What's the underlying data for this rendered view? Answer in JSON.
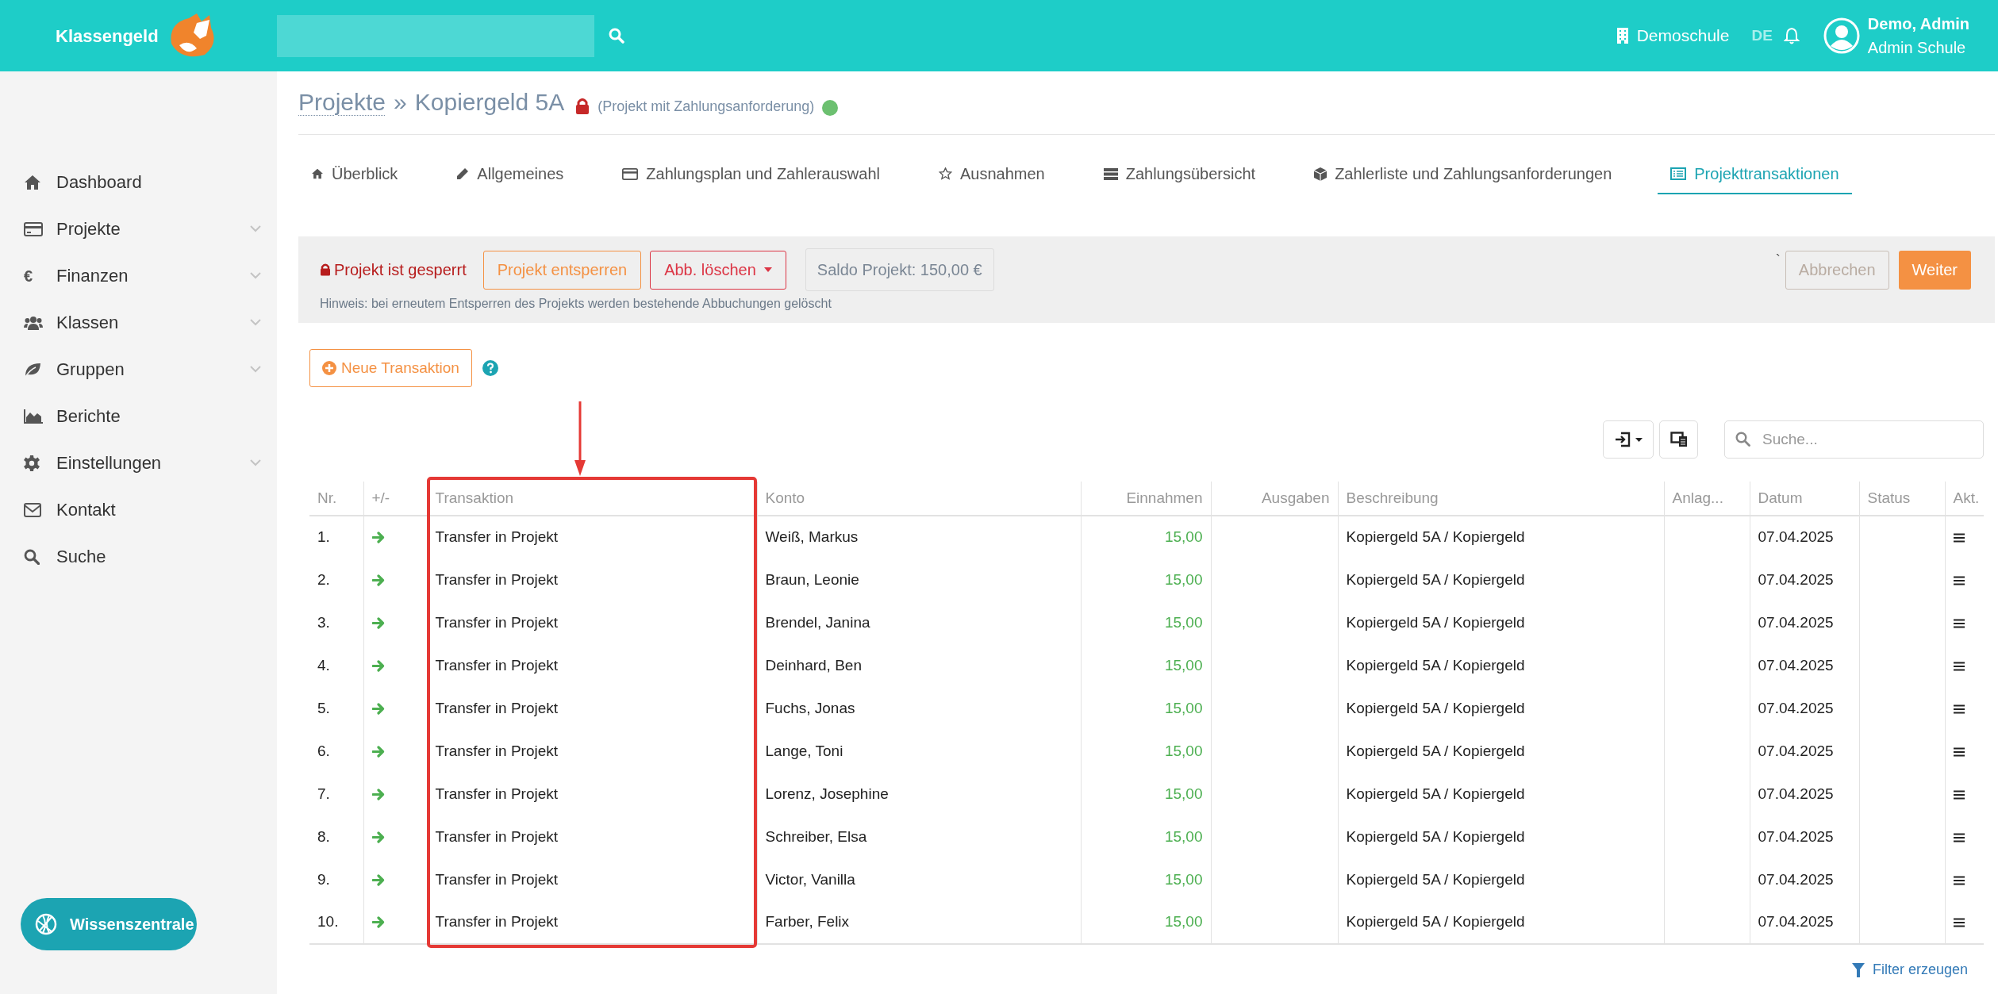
{
  "header": {
    "brand": "Klassengeld",
    "school": "Demoschule",
    "language": {
      "label": "DE",
      "selected": true
    },
    "user": {
      "name": "Demo, Admin",
      "role": "Admin Schule"
    }
  },
  "sidebar": {
    "items": [
      {
        "label": "Dashboard",
        "expandable": false
      },
      {
        "label": "Projekte",
        "expandable": true
      },
      {
        "label": "Finanzen",
        "expandable": true,
        "glyph": "€"
      },
      {
        "label": "Klassen",
        "expandable": true
      },
      {
        "label": "Gruppen",
        "expandable": true
      },
      {
        "label": "Berichte",
        "expandable": false
      },
      {
        "label": "Einstellungen",
        "expandable": true
      },
      {
        "label": "Kontakt",
        "expandable": false
      },
      {
        "label": "Suche",
        "expandable": false
      }
    ],
    "help_button": "Wissenszentrale"
  },
  "breadcrumb": {
    "parent": "Projekte",
    "separator": "»",
    "title": "Kopiergeld 5A",
    "subtitle": "(Projekt mit Zahlungsanforderung)"
  },
  "tabs": [
    {
      "label": "Überblick",
      "selected": false
    },
    {
      "label": "Allgemeines",
      "selected": false
    },
    {
      "label": "Zahlungsplan und Zahlerauswahl",
      "selected": false
    },
    {
      "label": "Ausnahmen",
      "selected": false
    },
    {
      "label": "Zahlungsübersicht",
      "selected": false
    },
    {
      "label": "Zahlerliste und Zahlungsanforderungen",
      "selected": false
    },
    {
      "label": "Projekttransaktionen",
      "selected": true
    }
  ],
  "lock_panel": {
    "status": "Projekt ist gesperrt",
    "unlock": "Projekt entsperren",
    "delete": "Abb. löschen",
    "balance": "Saldo Projekt: 150,00 €",
    "hint": "Hinweis: bei erneutem Entsperren des Projekts werden bestehende Abbuchungen gelöscht",
    "mark": "`",
    "cancel": {
      "label": "Abbrechen",
      "disabled": true
    },
    "next": "Weiter"
  },
  "new_transaction": "Neue Transaktion",
  "table_search": {
    "placeholder": "Suche..."
  },
  "table": {
    "columns": [
      "Nr.",
      "+/-",
      "Transaktion",
      "Konto",
      "Einnahmen",
      "Ausgaben",
      "Beschreibung",
      "Anlag...",
      "Datum",
      "Status",
      "Akt."
    ],
    "rows": [
      {
        "nr": "1.",
        "transaction": "Transfer in Projekt",
        "account": "Weiß, Markus",
        "income": "15,00",
        "description": "Kopiergeld 5A / Kopiergeld",
        "date": "07.04.2025"
      },
      {
        "nr": "2.",
        "transaction": "Transfer in Projekt",
        "account": "Braun, Leonie",
        "income": "15,00",
        "description": "Kopiergeld 5A / Kopiergeld",
        "date": "07.04.2025"
      },
      {
        "nr": "3.",
        "transaction": "Transfer in Projekt",
        "account": "Brendel, Janina",
        "income": "15,00",
        "description": "Kopiergeld 5A / Kopiergeld",
        "date": "07.04.2025"
      },
      {
        "nr": "4.",
        "transaction": "Transfer in Projekt",
        "account": "Deinhard, Ben",
        "income": "15,00",
        "description": "Kopiergeld 5A / Kopiergeld",
        "date": "07.04.2025"
      },
      {
        "nr": "5.",
        "transaction": "Transfer in Projekt",
        "account": "Fuchs, Jonas",
        "income": "15,00",
        "description": "Kopiergeld 5A / Kopiergeld",
        "date": "07.04.2025"
      },
      {
        "nr": "6.",
        "transaction": "Transfer in Projekt",
        "account": "Lange, Toni",
        "income": "15,00",
        "description": "Kopiergeld 5A / Kopiergeld",
        "date": "07.04.2025"
      },
      {
        "nr": "7.",
        "transaction": "Transfer in Projekt",
        "account": "Lorenz, Josephine",
        "income": "15,00",
        "description": "Kopiergeld 5A / Kopiergeld",
        "date": "07.04.2025"
      },
      {
        "nr": "8.",
        "transaction": "Transfer in Projekt",
        "account": "Schreiber, Elsa",
        "income": "15,00",
        "description": "Kopiergeld 5A / Kopiergeld",
        "date": "07.04.2025"
      },
      {
        "nr": "9.",
        "transaction": "Transfer in Projekt",
        "account": "Victor, Vanilla",
        "income": "15,00",
        "description": "Kopiergeld 5A / Kopiergeld",
        "date": "07.04.2025"
      },
      {
        "nr": "10.",
        "transaction": "Transfer in Projekt",
        "account": "Farber, Felix",
        "income": "15,00",
        "description": "Kopiergeld 5A / Kopiergeld",
        "date": "07.04.2025"
      }
    ]
  },
  "filter_link": "Filter erzeugen"
}
